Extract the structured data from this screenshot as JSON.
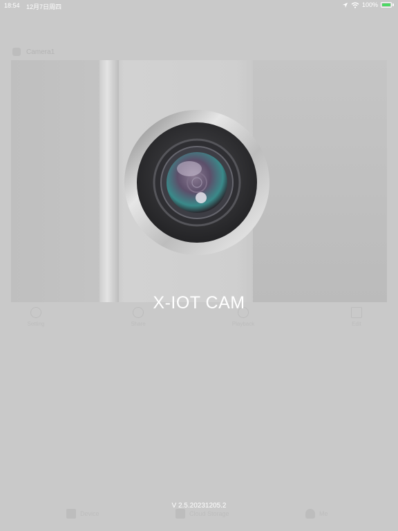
{
  "status_bar": {
    "time": "18:54",
    "date": "12月7日周四",
    "battery_percent": "100%"
  },
  "background_app": {
    "camera_name": "Camera1",
    "actions": [
      "Setting",
      "Share",
      "Playback",
      "Edit"
    ],
    "tabs": [
      "Device",
      "Cloud Storage",
      "Me"
    ]
  },
  "splash": {
    "title": "X-IOT CAM",
    "version": "V 2.5.20231205.2"
  },
  "colors": {
    "background": "#c9c9c9",
    "battery_green": "#4cd964",
    "text": "#ffffff"
  }
}
